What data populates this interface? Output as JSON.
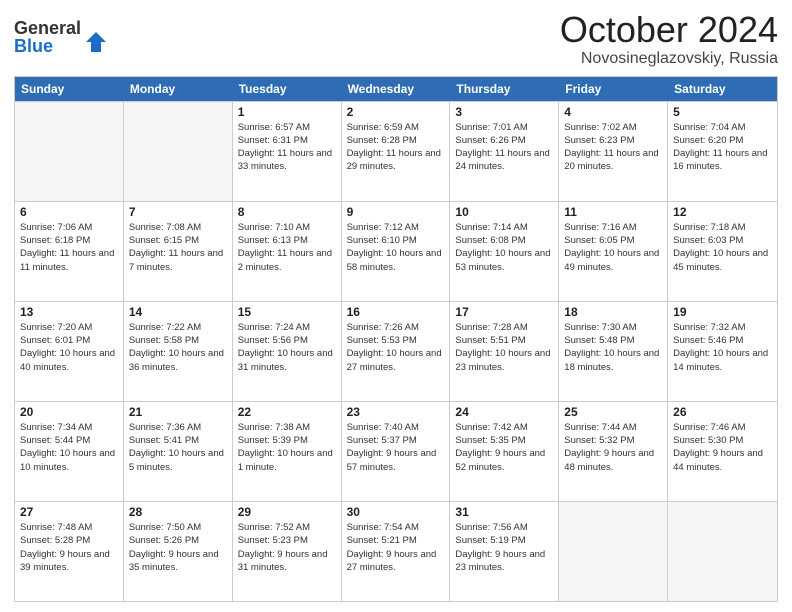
{
  "header": {
    "logo_line1": "General",
    "logo_line2": "Blue",
    "month": "October 2024",
    "location": "Novosineglazovskiy, Russia"
  },
  "days_of_week": [
    "Sunday",
    "Monday",
    "Tuesday",
    "Wednesday",
    "Thursday",
    "Friday",
    "Saturday"
  ],
  "weeks": [
    [
      {
        "day": "",
        "empty": true
      },
      {
        "day": "",
        "empty": true
      },
      {
        "day": "1",
        "sunrise": "Sunrise: 6:57 AM",
        "sunset": "Sunset: 6:31 PM",
        "daylight": "Daylight: 11 hours and 33 minutes."
      },
      {
        "day": "2",
        "sunrise": "Sunrise: 6:59 AM",
        "sunset": "Sunset: 6:28 PM",
        "daylight": "Daylight: 11 hours and 29 minutes."
      },
      {
        "day": "3",
        "sunrise": "Sunrise: 7:01 AM",
        "sunset": "Sunset: 6:26 PM",
        "daylight": "Daylight: 11 hours and 24 minutes."
      },
      {
        "day": "4",
        "sunrise": "Sunrise: 7:02 AM",
        "sunset": "Sunset: 6:23 PM",
        "daylight": "Daylight: 11 hours and 20 minutes."
      },
      {
        "day": "5",
        "sunrise": "Sunrise: 7:04 AM",
        "sunset": "Sunset: 6:20 PM",
        "daylight": "Daylight: 11 hours and 16 minutes."
      }
    ],
    [
      {
        "day": "6",
        "sunrise": "Sunrise: 7:06 AM",
        "sunset": "Sunset: 6:18 PM",
        "daylight": "Daylight: 11 hours and 11 minutes."
      },
      {
        "day": "7",
        "sunrise": "Sunrise: 7:08 AM",
        "sunset": "Sunset: 6:15 PM",
        "daylight": "Daylight: 11 hours and 7 minutes."
      },
      {
        "day": "8",
        "sunrise": "Sunrise: 7:10 AM",
        "sunset": "Sunset: 6:13 PM",
        "daylight": "Daylight: 11 hours and 2 minutes."
      },
      {
        "day": "9",
        "sunrise": "Sunrise: 7:12 AM",
        "sunset": "Sunset: 6:10 PM",
        "daylight": "Daylight: 10 hours and 58 minutes."
      },
      {
        "day": "10",
        "sunrise": "Sunrise: 7:14 AM",
        "sunset": "Sunset: 6:08 PM",
        "daylight": "Daylight: 10 hours and 53 minutes."
      },
      {
        "day": "11",
        "sunrise": "Sunrise: 7:16 AM",
        "sunset": "Sunset: 6:05 PM",
        "daylight": "Daylight: 10 hours and 49 minutes."
      },
      {
        "day": "12",
        "sunrise": "Sunrise: 7:18 AM",
        "sunset": "Sunset: 6:03 PM",
        "daylight": "Daylight: 10 hours and 45 minutes."
      }
    ],
    [
      {
        "day": "13",
        "sunrise": "Sunrise: 7:20 AM",
        "sunset": "Sunset: 6:01 PM",
        "daylight": "Daylight: 10 hours and 40 minutes."
      },
      {
        "day": "14",
        "sunrise": "Sunrise: 7:22 AM",
        "sunset": "Sunset: 5:58 PM",
        "daylight": "Daylight: 10 hours and 36 minutes."
      },
      {
        "day": "15",
        "sunrise": "Sunrise: 7:24 AM",
        "sunset": "Sunset: 5:56 PM",
        "daylight": "Daylight: 10 hours and 31 minutes."
      },
      {
        "day": "16",
        "sunrise": "Sunrise: 7:26 AM",
        "sunset": "Sunset: 5:53 PM",
        "daylight": "Daylight: 10 hours and 27 minutes."
      },
      {
        "day": "17",
        "sunrise": "Sunrise: 7:28 AM",
        "sunset": "Sunset: 5:51 PM",
        "daylight": "Daylight: 10 hours and 23 minutes."
      },
      {
        "day": "18",
        "sunrise": "Sunrise: 7:30 AM",
        "sunset": "Sunset: 5:48 PM",
        "daylight": "Daylight: 10 hours and 18 minutes."
      },
      {
        "day": "19",
        "sunrise": "Sunrise: 7:32 AM",
        "sunset": "Sunset: 5:46 PM",
        "daylight": "Daylight: 10 hours and 14 minutes."
      }
    ],
    [
      {
        "day": "20",
        "sunrise": "Sunrise: 7:34 AM",
        "sunset": "Sunset: 5:44 PM",
        "daylight": "Daylight: 10 hours and 10 minutes."
      },
      {
        "day": "21",
        "sunrise": "Sunrise: 7:36 AM",
        "sunset": "Sunset: 5:41 PM",
        "daylight": "Daylight: 10 hours and 5 minutes."
      },
      {
        "day": "22",
        "sunrise": "Sunrise: 7:38 AM",
        "sunset": "Sunset: 5:39 PM",
        "daylight": "Daylight: 10 hours and 1 minute."
      },
      {
        "day": "23",
        "sunrise": "Sunrise: 7:40 AM",
        "sunset": "Sunset: 5:37 PM",
        "daylight": "Daylight: 9 hours and 57 minutes."
      },
      {
        "day": "24",
        "sunrise": "Sunrise: 7:42 AM",
        "sunset": "Sunset: 5:35 PM",
        "daylight": "Daylight: 9 hours and 52 minutes."
      },
      {
        "day": "25",
        "sunrise": "Sunrise: 7:44 AM",
        "sunset": "Sunset: 5:32 PM",
        "daylight": "Daylight: 9 hours and 48 minutes."
      },
      {
        "day": "26",
        "sunrise": "Sunrise: 7:46 AM",
        "sunset": "Sunset: 5:30 PM",
        "daylight": "Daylight: 9 hours and 44 minutes."
      }
    ],
    [
      {
        "day": "27",
        "sunrise": "Sunrise: 7:48 AM",
        "sunset": "Sunset: 5:28 PM",
        "daylight": "Daylight: 9 hours and 39 minutes."
      },
      {
        "day": "28",
        "sunrise": "Sunrise: 7:50 AM",
        "sunset": "Sunset: 5:26 PM",
        "daylight": "Daylight: 9 hours and 35 minutes."
      },
      {
        "day": "29",
        "sunrise": "Sunrise: 7:52 AM",
        "sunset": "Sunset: 5:23 PM",
        "daylight": "Daylight: 9 hours and 31 minutes."
      },
      {
        "day": "30",
        "sunrise": "Sunrise: 7:54 AM",
        "sunset": "Sunset: 5:21 PM",
        "daylight": "Daylight: 9 hours and 27 minutes."
      },
      {
        "day": "31",
        "sunrise": "Sunrise: 7:56 AM",
        "sunset": "Sunset: 5:19 PM",
        "daylight": "Daylight: 9 hours and 23 minutes."
      },
      {
        "day": "",
        "empty": true
      },
      {
        "day": "",
        "empty": true
      }
    ]
  ]
}
